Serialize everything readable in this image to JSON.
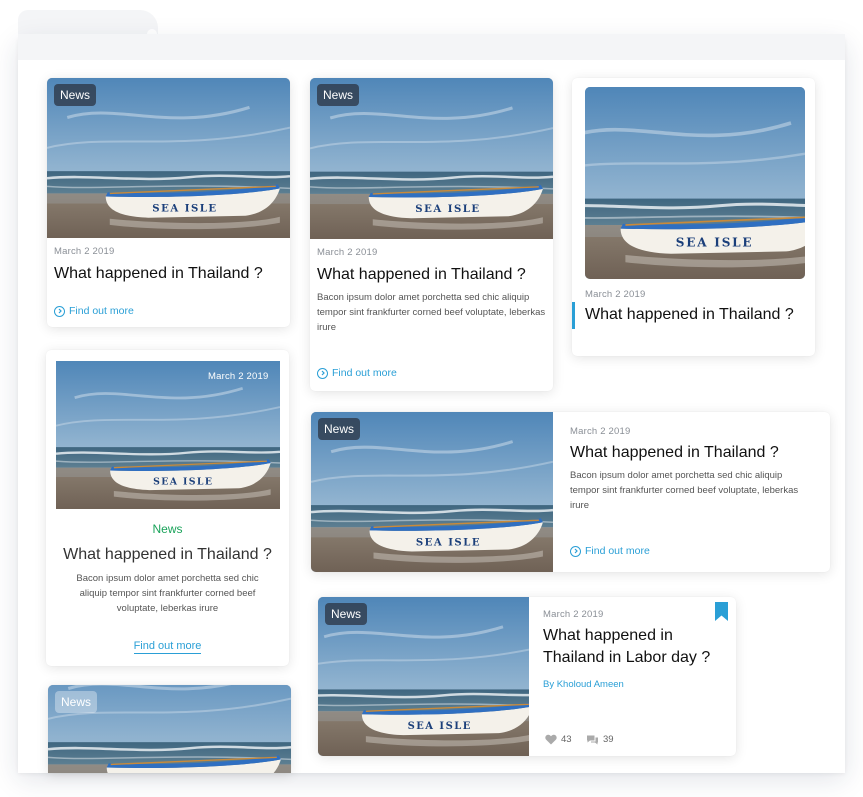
{
  "colors": {
    "accent": "#2a9fd6",
    "green_label": "#1aa35a"
  },
  "card1": {
    "badge": "News",
    "date": "March 2 2019",
    "title": "What happened in Thailand ?",
    "link": "Find out more"
  },
  "card2": {
    "badge": "News",
    "date": "March 2 2019",
    "title": "What happened in Thailand ?",
    "body": "Bacon ipsum dolor amet porchetta sed chic aliquip tempor sint frankfurter corned beef voluptate, leberkas irure",
    "link": "Find out more"
  },
  "card3": {
    "date": "March 2 2019",
    "title": "What happened in Thailand ?"
  },
  "card4": {
    "date": "March 2 2019",
    "category": "News",
    "title": "What happened in Thailand ?",
    "body": "Bacon ipsum dolor amet porchetta sed chic aliquip tempor sint frankfurter corned beef voluptate, leberkas irure",
    "link": "Find out more"
  },
  "card5": {
    "badge": "News",
    "date": "March 2 2019",
    "title": "What happened in Thailand ?",
    "body": "Bacon ipsum dolor amet porchetta sed chic aliquip tempor sint frankfurter corned beef voluptate, leberkas irure",
    "link": "Find out more"
  },
  "card6": {
    "badge": "News",
    "date": "March 2 2019",
    "title": "What happened in Thailand in Labor day ?",
    "author": "By Kholoud Ameen",
    "likes": "43",
    "comments": "39",
    "icons": {
      "bookmark": "bookmark-icon",
      "like": "heart-icon",
      "comment": "comment-icon"
    }
  },
  "card7": {
    "badge": "News"
  }
}
